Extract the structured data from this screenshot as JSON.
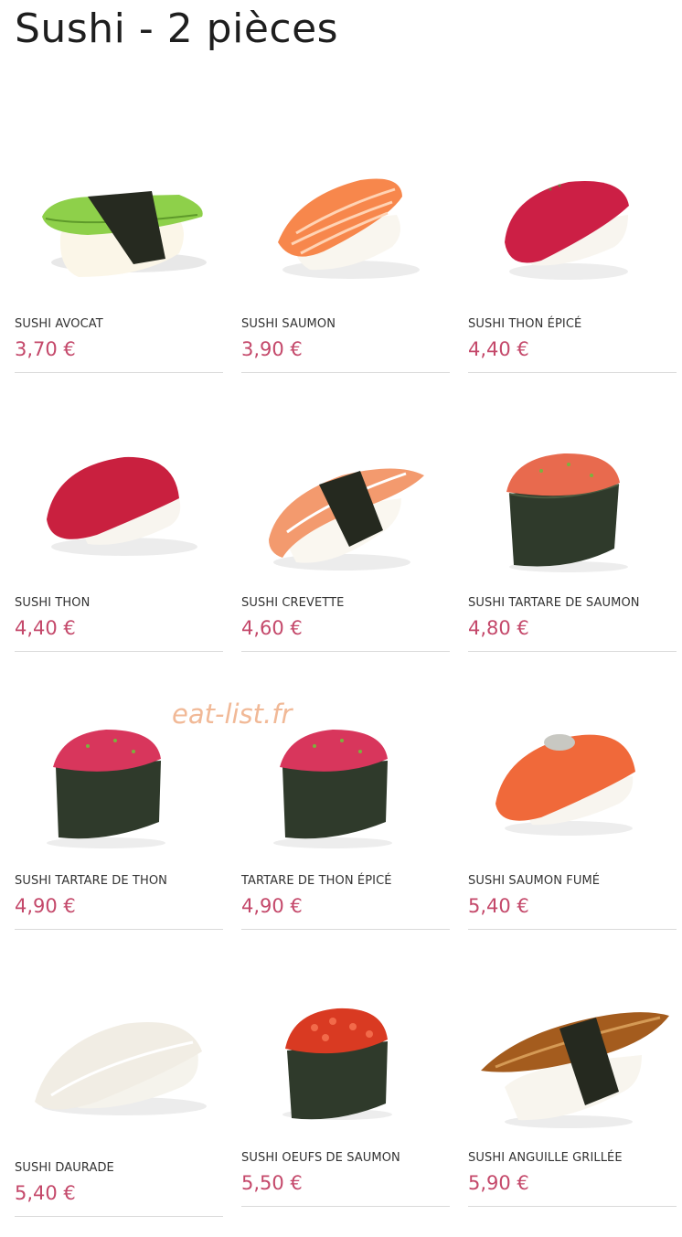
{
  "page": {
    "title": "Sushi - 2 pièces",
    "watermark": "eat-list.fr",
    "price_color": "#c4486a"
  },
  "items": [
    {
      "name": "SUSHI AVOCAT",
      "price": "3,70 €",
      "icon": "avocado-nigiri"
    },
    {
      "name": "SUSHI SAUMON",
      "price": "3,90 €",
      "icon": "salmon-nigiri"
    },
    {
      "name": "SUSHI THON ÉPICÉ",
      "price": "4,40 €",
      "icon": "spicy-tuna-nigiri"
    },
    {
      "name": "SUSHI THON",
      "price": "4,40 €",
      "icon": "tuna-nigiri"
    },
    {
      "name": "SUSHI CREVETTE",
      "price": "4,60 €",
      "icon": "shrimp-nigiri"
    },
    {
      "name": "SUSHI TARTARE DE SAUMON",
      "price": "4,80 €",
      "icon": "salmon-tartare-gunkan"
    },
    {
      "name": "SUSHI TARTARE DE THON",
      "price": "4,90 €",
      "icon": "tuna-tartare-gunkan"
    },
    {
      "name": "TARTARE DE THON ÉPICÉ",
      "price": "4,90 €",
      "icon": "spicy-tuna-tartare-gunkan"
    },
    {
      "name": "SUSHI SAUMON FUMÉ",
      "price": "5,40 €",
      "icon": "smoked-salmon-nigiri"
    },
    {
      "name": "SUSHI DAURADE",
      "price": "5,40 €",
      "icon": "sea-bream-nigiri"
    },
    {
      "name": "SUSHI OEUFS DE SAUMON",
      "price": "5,50 €",
      "icon": "salmon-roe-gunkan"
    },
    {
      "name": "SUSHI ANGUILLE GRILLÉE",
      "price": "5,90 €",
      "icon": "grilled-eel-nigiri"
    }
  ]
}
